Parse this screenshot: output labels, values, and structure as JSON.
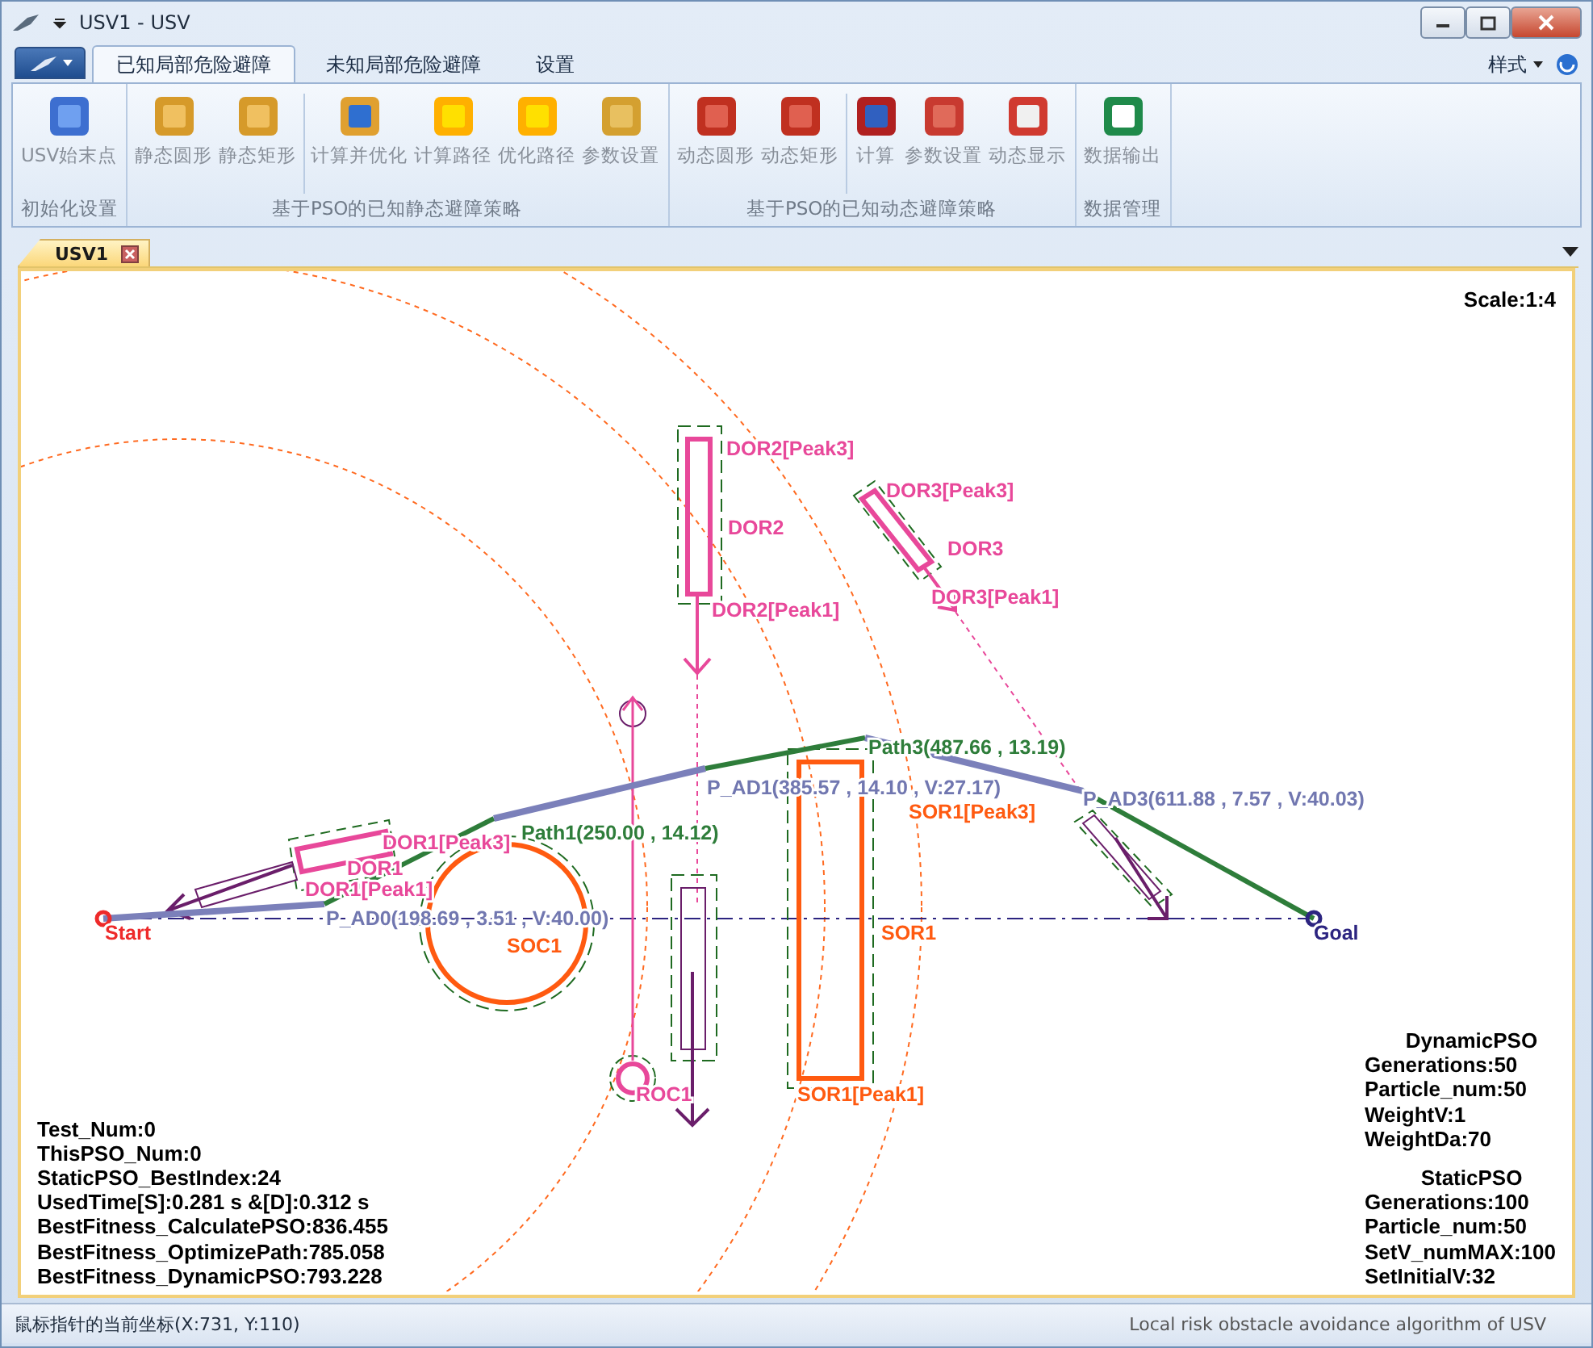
{
  "window": {
    "title": "USV1 - USV"
  },
  "ribbon": {
    "tabs": [
      {
        "label": "已知局部危险避障",
        "selected": true
      },
      {
        "label": "未知局部危险避障",
        "selected": false
      },
      {
        "label": "设置",
        "selected": false
      }
    ],
    "style_menu": "样式",
    "groups": [
      {
        "label": "初始化设置",
        "buttons": [
          {
            "label": "USV始末点",
            "separator_before": false
          }
        ]
      },
      {
        "label": "基于PSO的已知静态避障策略",
        "buttons": [
          {
            "label": "静态圆形",
            "separator_before": false
          },
          {
            "label": "静态矩形",
            "separator_before": false
          },
          {
            "label": "计算并优化",
            "separator_before": true
          },
          {
            "label": "计算路径",
            "separator_before": false
          },
          {
            "label": "优化路径",
            "separator_before": false
          },
          {
            "label": "参数设置",
            "separator_before": false
          }
        ]
      },
      {
        "label": "基于PSO的已知动态避障策略",
        "buttons": [
          {
            "label": "动态圆形",
            "separator_before": false
          },
          {
            "label": "动态矩形",
            "separator_before": false
          },
          {
            "label": "计算",
            "separator_before": true
          },
          {
            "label": "参数设置",
            "separator_before": false
          },
          {
            "label": "动态显示",
            "separator_before": false
          }
        ]
      },
      {
        "label": "数据管理",
        "buttons": [
          {
            "label": "数据输出",
            "separator_before": false
          }
        ]
      }
    ]
  },
  "document_tabs": [
    {
      "label": "USV1",
      "selected": true
    }
  ],
  "canvas": {
    "scale": "Scale:1:4",
    "labels": [
      {
        "text": "DOR2[Peak3]",
        "color": "#e8489a"
      },
      {
        "text": "DOR2",
        "color": "#e8489a"
      },
      {
        "text": "DOR2[Peak1]",
        "color": "#e8489a"
      },
      {
        "text": "DOR3[Peak3]",
        "color": "#e8489a"
      },
      {
        "text": "DOR3",
        "color": "#e8489a"
      },
      {
        "text": "DOR3[Peak1]",
        "color": "#e8489a"
      },
      {
        "text": "Path3(487.66 , 13.19)",
        "color": "#2e7d3a"
      },
      {
        "text": "P_AD1(385.57 , 14.10 , V:27.17)",
        "color": "#7177b0"
      },
      {
        "text": "SOR1[Peak3]",
        "color": "#ff5a10"
      },
      {
        "text": "P_AD3(611.88 , 7.57 , V:40.03)",
        "color": "#7177b0"
      },
      {
        "text": "Path1(250.00 , 14.12)",
        "color": "#2e7d3a"
      },
      {
        "text": "DOR1[Peak3]",
        "color": "#e8489a"
      },
      {
        "text": "DOR1",
        "color": "#e8489a"
      },
      {
        "text": "DOR1[Peak1]",
        "color": "#e8489a"
      },
      {
        "text": "Start",
        "color": "#ee2a2a"
      },
      {
        "text": "P_AD0(198.69 , 3.51 , V:40.00)",
        "color": "#7177b0"
      },
      {
        "text": "SOC1",
        "color": "#ff5a10"
      },
      {
        "text": "SOR1",
        "color": "#ff5a10"
      },
      {
        "text": "Goal",
        "color": "#2c2480"
      },
      {
        "text": "ROC1",
        "color": "#e8489a"
      },
      {
        "text": "SOR1[Peak1]",
        "color": "#ff5a10"
      }
    ],
    "stats_left": [
      "Test_Num:0",
      "ThisPSO_Num:0",
      "StaticPSO_BestIndex:24",
      "UsedTime[S]:0.281 s &[D]:0.312 s",
      "BestFitness_CalculatePSO:836.455",
      "BestFitness_OptimizePath:785.058",
      "BestFitness_DynamicPSO:793.228"
    ],
    "stats_right": [
      {
        "heading": "DynamicPSO",
        "lines": [
          "Generations:50",
          "Particle_num:50",
          "WeightV:1",
          "WeightDa:70"
        ]
      },
      {
        "heading": "StaticPSO",
        "lines": [
          "Generations:100",
          "Particle_num:50",
          "SetV_numMAX:100",
          "SetInitialV:32"
        ]
      }
    ]
  },
  "status_bar": {
    "coordinates": "鼠标指针的当前坐标(X:731, Y:110)",
    "description": "Local risk obstacle avoidance algorithm of USV"
  }
}
